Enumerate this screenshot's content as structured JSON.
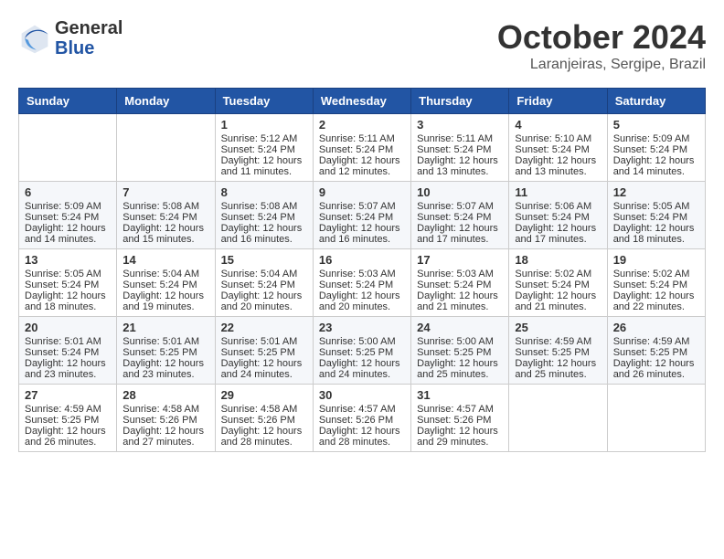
{
  "logo": {
    "general": "General",
    "blue": "Blue"
  },
  "title": "October 2024",
  "location": "Laranjeiras, Sergipe, Brazil",
  "weekdays": [
    "Sunday",
    "Monday",
    "Tuesday",
    "Wednesday",
    "Thursday",
    "Friday",
    "Saturday"
  ],
  "weeks": [
    [
      {
        "day": "",
        "sunrise": "",
        "sunset": "",
        "daylight": ""
      },
      {
        "day": "",
        "sunrise": "",
        "sunset": "",
        "daylight": ""
      },
      {
        "day": "1",
        "sunrise": "Sunrise: 5:12 AM",
        "sunset": "Sunset: 5:24 PM",
        "daylight": "Daylight: 12 hours and 11 minutes."
      },
      {
        "day": "2",
        "sunrise": "Sunrise: 5:11 AM",
        "sunset": "Sunset: 5:24 PM",
        "daylight": "Daylight: 12 hours and 12 minutes."
      },
      {
        "day": "3",
        "sunrise": "Sunrise: 5:11 AM",
        "sunset": "Sunset: 5:24 PM",
        "daylight": "Daylight: 12 hours and 13 minutes."
      },
      {
        "day": "4",
        "sunrise": "Sunrise: 5:10 AM",
        "sunset": "Sunset: 5:24 PM",
        "daylight": "Daylight: 12 hours and 13 minutes."
      },
      {
        "day": "5",
        "sunrise": "Sunrise: 5:09 AM",
        "sunset": "Sunset: 5:24 PM",
        "daylight": "Daylight: 12 hours and 14 minutes."
      }
    ],
    [
      {
        "day": "6",
        "sunrise": "Sunrise: 5:09 AM",
        "sunset": "Sunset: 5:24 PM",
        "daylight": "Daylight: 12 hours and 14 minutes."
      },
      {
        "day": "7",
        "sunrise": "Sunrise: 5:08 AM",
        "sunset": "Sunset: 5:24 PM",
        "daylight": "Daylight: 12 hours and 15 minutes."
      },
      {
        "day": "8",
        "sunrise": "Sunrise: 5:08 AM",
        "sunset": "Sunset: 5:24 PM",
        "daylight": "Daylight: 12 hours and 16 minutes."
      },
      {
        "day": "9",
        "sunrise": "Sunrise: 5:07 AM",
        "sunset": "Sunset: 5:24 PM",
        "daylight": "Daylight: 12 hours and 16 minutes."
      },
      {
        "day": "10",
        "sunrise": "Sunrise: 5:07 AM",
        "sunset": "Sunset: 5:24 PM",
        "daylight": "Daylight: 12 hours and 17 minutes."
      },
      {
        "day": "11",
        "sunrise": "Sunrise: 5:06 AM",
        "sunset": "Sunset: 5:24 PM",
        "daylight": "Daylight: 12 hours and 17 minutes."
      },
      {
        "day": "12",
        "sunrise": "Sunrise: 5:05 AM",
        "sunset": "Sunset: 5:24 PM",
        "daylight": "Daylight: 12 hours and 18 minutes."
      }
    ],
    [
      {
        "day": "13",
        "sunrise": "Sunrise: 5:05 AM",
        "sunset": "Sunset: 5:24 PM",
        "daylight": "Daylight: 12 hours and 18 minutes."
      },
      {
        "day": "14",
        "sunrise": "Sunrise: 5:04 AM",
        "sunset": "Sunset: 5:24 PM",
        "daylight": "Daylight: 12 hours and 19 minutes."
      },
      {
        "day": "15",
        "sunrise": "Sunrise: 5:04 AM",
        "sunset": "Sunset: 5:24 PM",
        "daylight": "Daylight: 12 hours and 20 minutes."
      },
      {
        "day": "16",
        "sunrise": "Sunrise: 5:03 AM",
        "sunset": "Sunset: 5:24 PM",
        "daylight": "Daylight: 12 hours and 20 minutes."
      },
      {
        "day": "17",
        "sunrise": "Sunrise: 5:03 AM",
        "sunset": "Sunset: 5:24 PM",
        "daylight": "Daylight: 12 hours and 21 minutes."
      },
      {
        "day": "18",
        "sunrise": "Sunrise: 5:02 AM",
        "sunset": "Sunset: 5:24 PM",
        "daylight": "Daylight: 12 hours and 21 minutes."
      },
      {
        "day": "19",
        "sunrise": "Sunrise: 5:02 AM",
        "sunset": "Sunset: 5:24 PM",
        "daylight": "Daylight: 12 hours and 22 minutes."
      }
    ],
    [
      {
        "day": "20",
        "sunrise": "Sunrise: 5:01 AM",
        "sunset": "Sunset: 5:24 PM",
        "daylight": "Daylight: 12 hours and 23 minutes."
      },
      {
        "day": "21",
        "sunrise": "Sunrise: 5:01 AM",
        "sunset": "Sunset: 5:25 PM",
        "daylight": "Daylight: 12 hours and 23 minutes."
      },
      {
        "day": "22",
        "sunrise": "Sunrise: 5:01 AM",
        "sunset": "Sunset: 5:25 PM",
        "daylight": "Daylight: 12 hours and 24 minutes."
      },
      {
        "day": "23",
        "sunrise": "Sunrise: 5:00 AM",
        "sunset": "Sunset: 5:25 PM",
        "daylight": "Daylight: 12 hours and 24 minutes."
      },
      {
        "day": "24",
        "sunrise": "Sunrise: 5:00 AM",
        "sunset": "Sunset: 5:25 PM",
        "daylight": "Daylight: 12 hours and 25 minutes."
      },
      {
        "day": "25",
        "sunrise": "Sunrise: 4:59 AM",
        "sunset": "Sunset: 5:25 PM",
        "daylight": "Daylight: 12 hours and 25 minutes."
      },
      {
        "day": "26",
        "sunrise": "Sunrise: 4:59 AM",
        "sunset": "Sunset: 5:25 PM",
        "daylight": "Daylight: 12 hours and 26 minutes."
      }
    ],
    [
      {
        "day": "27",
        "sunrise": "Sunrise: 4:59 AM",
        "sunset": "Sunset: 5:25 PM",
        "daylight": "Daylight: 12 hours and 26 minutes."
      },
      {
        "day": "28",
        "sunrise": "Sunrise: 4:58 AM",
        "sunset": "Sunset: 5:26 PM",
        "daylight": "Daylight: 12 hours and 27 minutes."
      },
      {
        "day": "29",
        "sunrise": "Sunrise: 4:58 AM",
        "sunset": "Sunset: 5:26 PM",
        "daylight": "Daylight: 12 hours and 28 minutes."
      },
      {
        "day": "30",
        "sunrise": "Sunrise: 4:57 AM",
        "sunset": "Sunset: 5:26 PM",
        "daylight": "Daylight: 12 hours and 28 minutes."
      },
      {
        "day": "31",
        "sunrise": "Sunrise: 4:57 AM",
        "sunset": "Sunset: 5:26 PM",
        "daylight": "Daylight: 12 hours and 29 minutes."
      },
      {
        "day": "",
        "sunrise": "",
        "sunset": "",
        "daylight": ""
      },
      {
        "day": "",
        "sunrise": "",
        "sunset": "",
        "daylight": ""
      }
    ]
  ]
}
